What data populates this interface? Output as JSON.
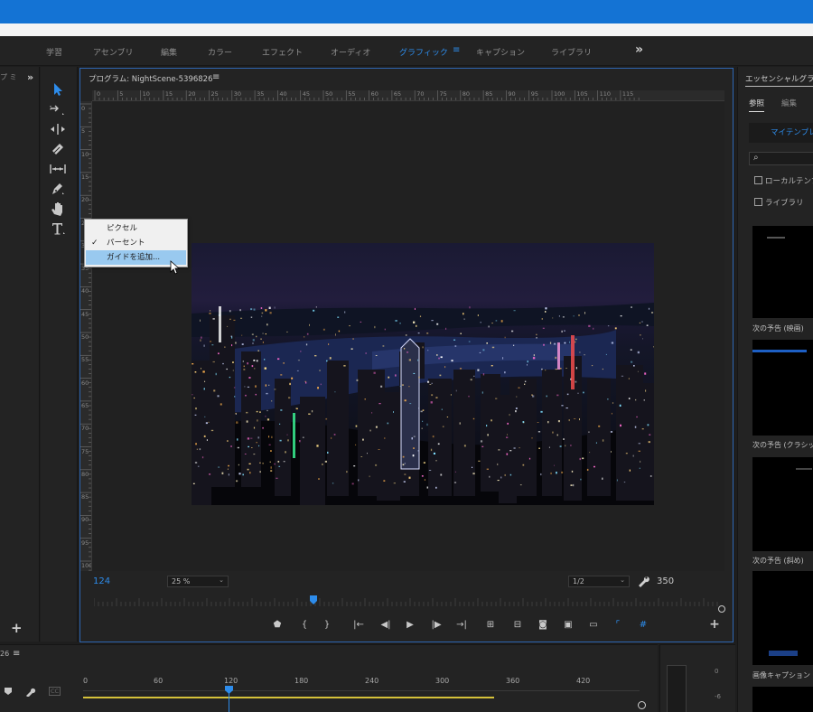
{
  "workspaces": {
    "tabs": [
      {
        "label": "学習",
        "active": false
      },
      {
        "label": "アセンブリ",
        "active": false
      },
      {
        "label": "編集",
        "active": false
      },
      {
        "label": "カラー",
        "active": false
      },
      {
        "label": "エフェクト",
        "active": false
      },
      {
        "label": "オーディオ",
        "active": false
      },
      {
        "label": "グラフィック",
        "active": true
      },
      {
        "label": "キャプション",
        "active": false
      },
      {
        "label": "ライブラリ",
        "active": false
      }
    ],
    "menu_icon": "≡",
    "overflow_icon": "»"
  },
  "left_panel": {
    "title_fragment": "プ ミ",
    "collapse_icon": "»",
    "add_icon": "+"
  },
  "tools": [
    {
      "name": "selection-tool-icon"
    },
    {
      "name": "track-select-tool-icon"
    },
    {
      "name": "ripple-edit-tool-icon"
    },
    {
      "name": "razor-tool-icon"
    },
    {
      "name": "slip-tool-icon"
    },
    {
      "name": "pen-tool-icon"
    },
    {
      "name": "hand-tool-icon"
    },
    {
      "name": "type-tool-icon"
    }
  ],
  "monitor": {
    "title": "プログラム: NightScene-5396826",
    "menu_icon": "≡",
    "ruler_top_labels": [
      "0",
      "5",
      "10",
      "15",
      "20",
      "25",
      "30",
      "35",
      "40",
      "45",
      "50",
      "55",
      "60",
      "65",
      "70",
      "75",
      "80",
      "85",
      "90",
      "95",
      "100",
      "105",
      "110",
      "115"
    ],
    "ruler_left_labels": [
      "0",
      "5",
      "10",
      "15",
      "20",
      "25",
      "30",
      "35",
      "40",
      "45",
      "50",
      "55",
      "60",
      "65",
      "70",
      "75",
      "80",
      "85",
      "90",
      "95",
      "100"
    ],
    "timecode_in": "124",
    "zoom": "25 %",
    "resolution": "1/2",
    "duration": "350",
    "playhead_fraction": 0.35,
    "controls": [
      {
        "name": "add-marker-button",
        "glyph": "⬟"
      },
      {
        "name": "mark-in-button",
        "glyph": "{"
      },
      {
        "name": "mark-out-button",
        "glyph": "}"
      },
      {
        "name": "go-to-in-button",
        "glyph": "|←"
      },
      {
        "name": "step-back-button",
        "glyph": "◀|"
      },
      {
        "name": "play-button",
        "glyph": "▶"
      },
      {
        "name": "step-forward-button",
        "glyph": "|▶"
      },
      {
        "name": "go-to-out-button",
        "glyph": "→|"
      },
      {
        "name": "lift-button",
        "glyph": "⊞"
      },
      {
        "name": "extract-button",
        "glyph": "⊟"
      },
      {
        "name": "export-frame-button",
        "glyph": "◙"
      },
      {
        "name": "comparison-view-button",
        "glyph": "▣"
      },
      {
        "name": "safe-margins-button",
        "glyph": "▭"
      },
      {
        "name": "rulers-toggle-button",
        "glyph": "⌜"
      },
      {
        "name": "guides-toggle-button",
        "glyph": "#"
      },
      {
        "name": "add-control-button",
        "glyph": "+"
      }
    ]
  },
  "context_menu": {
    "items": [
      {
        "label": "ピクセル",
        "checked": false,
        "hover": false
      },
      {
        "label": "パーセント",
        "checked": true,
        "hover": false
      },
      {
        "label": "ガイドを追加...",
        "checked": false,
        "hover": true
      }
    ],
    "check_glyph": "✓"
  },
  "essential_graphics": {
    "title": "エッセンシャルグラフィックス",
    "tabs": {
      "browse": "参照",
      "edit": "編集"
    },
    "my_templates": "マイテンプレート",
    "search_icon": "⌕",
    "local_templates": "ローカルテンプレート",
    "libraries": "ライブラリ",
    "templates": [
      {
        "label": "次の予告 (映画)"
      },
      {
        "label": "次の予告 (クラシック)"
      },
      {
        "label": "次の予告 (斜め)"
      },
      {
        "label": "画像キャプション"
      }
    ],
    "thumb_caption": "画像キャプション"
  },
  "timeline": {
    "tab_fragment": "26",
    "menu_icon": "≡",
    "ticks": [
      "0",
      "60",
      "120",
      "180",
      "240",
      "300",
      "360",
      "420"
    ],
    "cc_label": "CC"
  },
  "meter": {
    "labels": [
      "0",
      "-6"
    ]
  },
  "colors": {
    "accent": "#2d8ceb",
    "titlebar": "#1473d4",
    "track": "#d6c23a",
    "menu_hover": "#99c9ef"
  }
}
